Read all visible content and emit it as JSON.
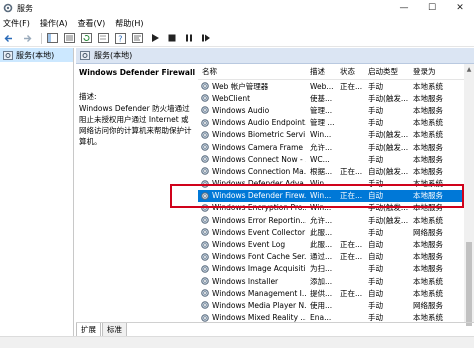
{
  "window": {
    "title": "服务",
    "controls": [
      "—",
      "☐",
      "✕"
    ]
  },
  "menu": [
    "文件(F)",
    "操作(A)",
    "查看(V)",
    "帮助(H)"
  ],
  "toolbar": {
    "icons": [
      "back-icon",
      "forward-icon",
      "console-tree-icon",
      "list-icon",
      "refresh-icon",
      "export-icon",
      "help-icon",
      "properties-icon",
      "play-icon",
      "stop-icon",
      "pause-icon",
      "restart-icon"
    ]
  },
  "tree": {
    "root_label": "服务(本地)"
  },
  "header": {
    "label": "服务(本地)"
  },
  "description": {
    "service_name": "Windows Defender Firewall",
    "desc_label": "描述:",
    "desc_text": "Windows Defender 防火墙通过阻止未授权用户通过 Internet 或网络访问你的计算机来帮助保护计算机。"
  },
  "columns": {
    "name": "名称",
    "desc": "描述",
    "status": "状态",
    "startup": "启动类型",
    "logon": "登录为"
  },
  "rows": [
    {
      "name": "Web 帐户管理器",
      "desc": "Web...",
      "status": "正在...",
      "startup": "手动",
      "logon": "本地系统"
    },
    {
      "name": "WebClient",
      "desc": "使基...",
      "status": "",
      "startup": "手动(触发...",
      "logon": "本地服务"
    },
    {
      "name": "Windows Audio",
      "desc": "管理...",
      "status": "",
      "startup": "手动",
      "logon": "本地服务"
    },
    {
      "name": "Windows Audio Endpoint...",
      "desc": "管理 ...",
      "status": "",
      "startup": "手动",
      "logon": "本地系统"
    },
    {
      "name": "Windows Biometric Servi...",
      "desc": "Win...",
      "status": "",
      "startup": "手动(触发...",
      "logon": "本地系统"
    },
    {
      "name": "Windows Camera Frame ...",
      "desc": "允许...",
      "status": "",
      "startup": "手动(触发...",
      "logon": "本地服务"
    },
    {
      "name": "Windows Connect Now - ...",
      "desc": "WC...",
      "status": "",
      "startup": "手动",
      "logon": "本地服务"
    },
    {
      "name": "Windows Connection Ma...",
      "desc": "根据...",
      "status": "正在...",
      "startup": "自动(触发...",
      "logon": "本地服务"
    },
    {
      "name": "Windows Defender Adva...",
      "desc": "Win...",
      "status": "",
      "startup": "手动",
      "logon": "本地系统"
    },
    {
      "name": "Windows Defender Firew...",
      "desc": "Win...",
      "status": "正在...",
      "startup": "自动",
      "logon": "本地服务"
    },
    {
      "name": "Windows Encryption Pro...",
      "desc": "Win...",
      "status": "",
      "startup": "手动(触发...",
      "logon": "本地服务"
    },
    {
      "name": "Windows Error Reportin...",
      "desc": "允许...",
      "status": "",
      "startup": "手动(触发...",
      "logon": "本地系统"
    },
    {
      "name": "Windows Event Collector",
      "desc": "此服...",
      "status": "",
      "startup": "手动",
      "logon": "网络服务"
    },
    {
      "name": "Windows Event Log",
      "desc": "此服...",
      "status": "正在...",
      "startup": "自动",
      "logon": "本地服务"
    },
    {
      "name": "Windows Font Cache Ser...",
      "desc": "通过...",
      "status": "正在...",
      "startup": "自动",
      "logon": "本地服务"
    },
    {
      "name": "Windows Image Acquisiti...",
      "desc": "为扫...",
      "status": "",
      "startup": "手动",
      "logon": "本地服务"
    },
    {
      "name": "Windows Installer",
      "desc": "添加...",
      "status": "",
      "startup": "手动",
      "logon": "本地系统"
    },
    {
      "name": "Windows Management I...",
      "desc": "提供...",
      "status": "正在...",
      "startup": "自动",
      "logon": "本地系统"
    },
    {
      "name": "Windows Media Player N...",
      "desc": "使用...",
      "status": "",
      "startup": "手动",
      "logon": "网络服务"
    },
    {
      "name": "Windows Mixed Reality ...",
      "desc": "Ena...",
      "status": "",
      "startup": "手动",
      "logon": "本地系统"
    }
  ],
  "selected_row": 9,
  "tabs": [
    "扩展",
    "标准"
  ],
  "colors": {
    "selection": "#0078d7",
    "highlight_box": "#d0021b",
    "header_band": "#dbe5f3"
  }
}
